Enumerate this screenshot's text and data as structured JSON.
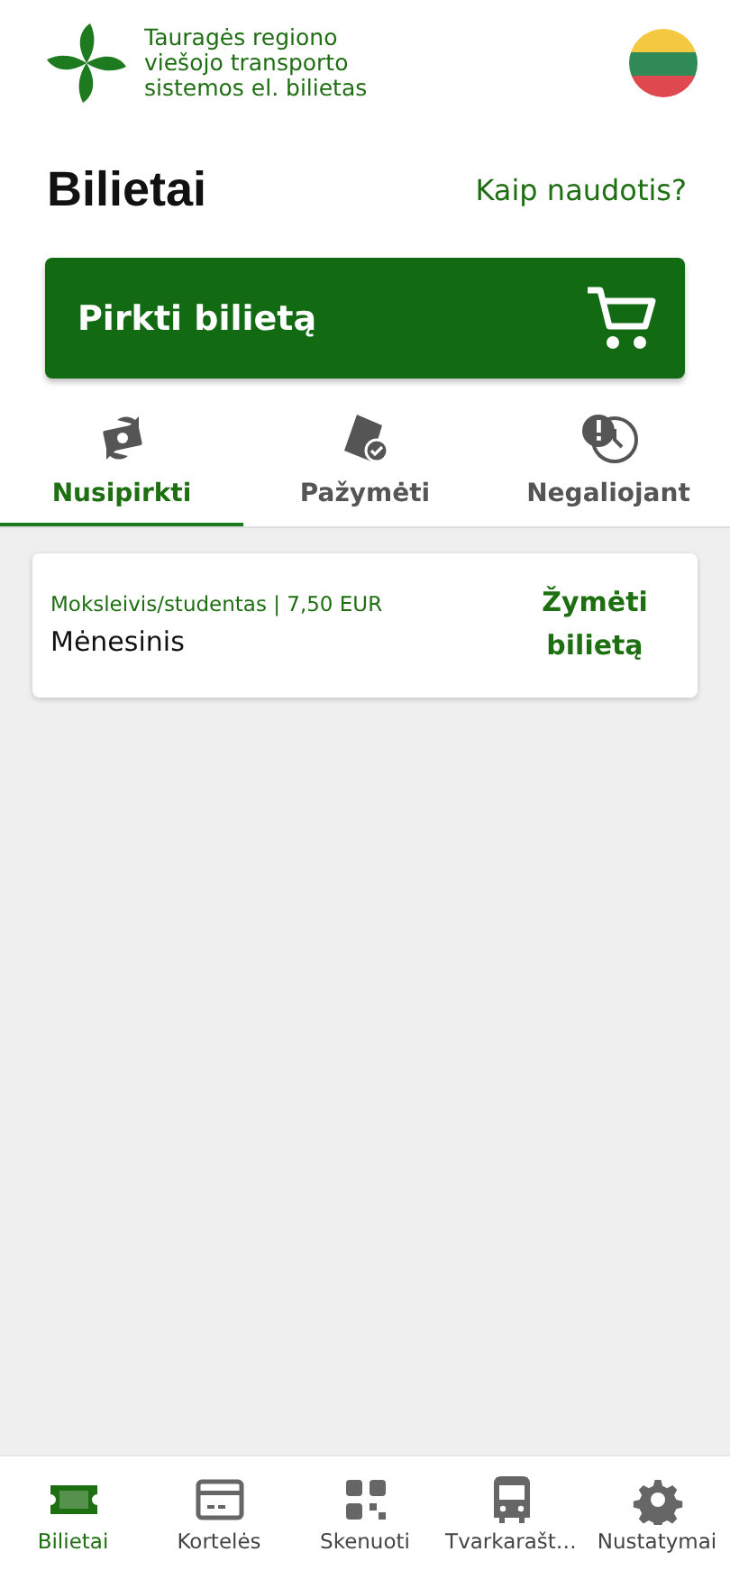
{
  "header": {
    "logo_text": [
      "Tauragės regiono",
      "viešojo transporto",
      "sistemos el. bilietas"
    ]
  },
  "page": {
    "title": "Bilietai",
    "help_link": "Kaip naudotis?"
  },
  "buy_button": {
    "label": "Pirkti bilietą"
  },
  "tabs": [
    {
      "label": "Nusipirkti",
      "selected": true
    },
    {
      "label": "Pažymėti",
      "selected": false
    },
    {
      "label": "Negaliojant",
      "selected": false
    }
  ],
  "tickets": [
    {
      "category": "Moksleivis/studentas | 7,50 EUR",
      "name": "Mėnesinis",
      "action": "Žymėti bilietą"
    }
  ],
  "bottom_nav": [
    {
      "label": "Bilietai",
      "selected": true
    },
    {
      "label": "Kortelės",
      "selected": false
    },
    {
      "label": "Skenuoti",
      "selected": false
    },
    {
      "label": "Tvarkarašt…",
      "selected": false
    },
    {
      "label": "Nustatymai",
      "selected": false
    }
  ]
}
